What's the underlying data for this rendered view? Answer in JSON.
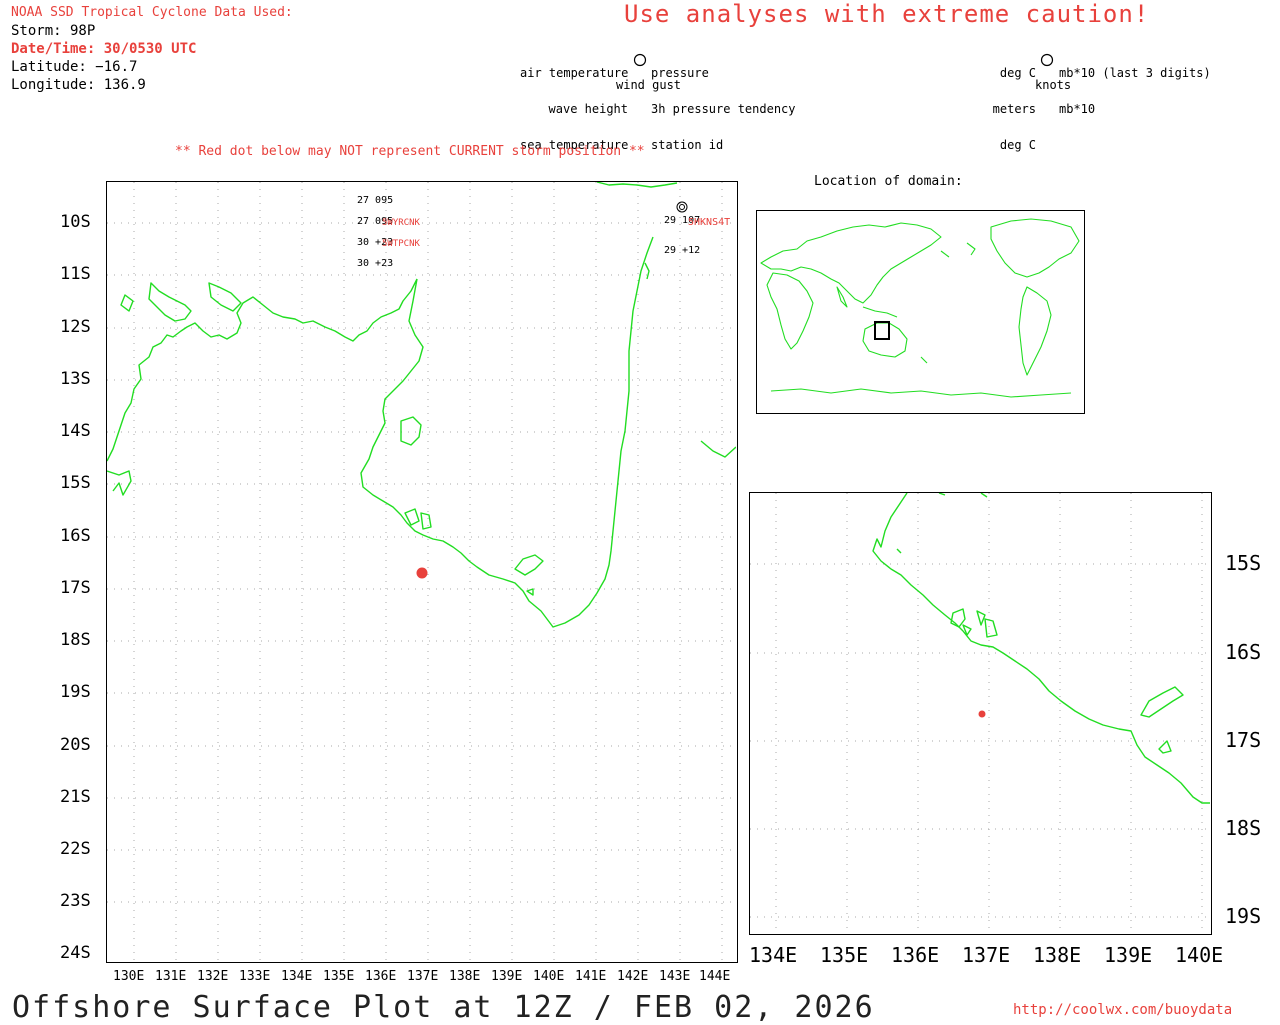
{
  "header": {
    "source": "NOAA SSD Tropical Cyclone Data Used:",
    "storm": "Storm: 98P",
    "datetime": "Date/Time: 30/0530 UTC",
    "latitude": "Latitude: −16.7",
    "longitude": "Longitude: 136.9",
    "caution": "Use analyses with extreme caution!"
  },
  "legend": {
    "left": [
      "air temperature",
      "wave height",
      "sea temperature"
    ],
    "right": [
      "pressure",
      "3h pressure tendency",
      "station id"
    ],
    "bottom": "wind gust",
    "units_left": [
      "deg C",
      "meters",
      "deg C"
    ],
    "units_right": [
      "mb*10 (last 3 digits)",
      "mb*10",
      "knots"
    ]
  },
  "warning": "** Red dot below may NOT represent CURRENT storm position **",
  "inset_title": "Location of domain:",
  "main_map": {
    "lat_labels": [
      "10S",
      "11S",
      "12S",
      "13S",
      "14S",
      "15S",
      "16S",
      "17S",
      "18S",
      "19S",
      "20S",
      "21S",
      "22S",
      "23S",
      "24S"
    ],
    "lon_labels": [
      "130E",
      "131E",
      "132E",
      "133E",
      "134E",
      "135E",
      "136E",
      "137E",
      "138E",
      "139E",
      "140E",
      "141E",
      "142E",
      "143E",
      "144E"
    ],
    "storm_position": {
      "lat": -16.7,
      "lon": 136.9
    }
  },
  "zoom_map": {
    "lat_labels": [
      "15S",
      "16S",
      "17S",
      "18S",
      "19S"
    ],
    "lon_labels": [
      "134E",
      "135E",
      "136E",
      "137E",
      "138E",
      "139E",
      "140E"
    ]
  },
  "stations": [
    {
      "lines": [
        "27 095",
        "27 095",
        "30 +23",
        "30 +23"
      ],
      "ids": [
        "5WYRCNK",
        "5WTPCNK"
      ]
    },
    {
      "lines": [
        "29 107",
        "29 +12"
      ],
      "ids": [
        "5HKNS4T"
      ]
    }
  ],
  "footer": {
    "title": "Offshore Surface Plot at 12Z / FEB 02, 2026",
    "url": "http://coolwx.com/buoydata"
  },
  "colors": {
    "land": "#22dd22",
    "storm": "#e8413c",
    "grid": "#aaaaaa",
    "accent": "#e8413c"
  }
}
